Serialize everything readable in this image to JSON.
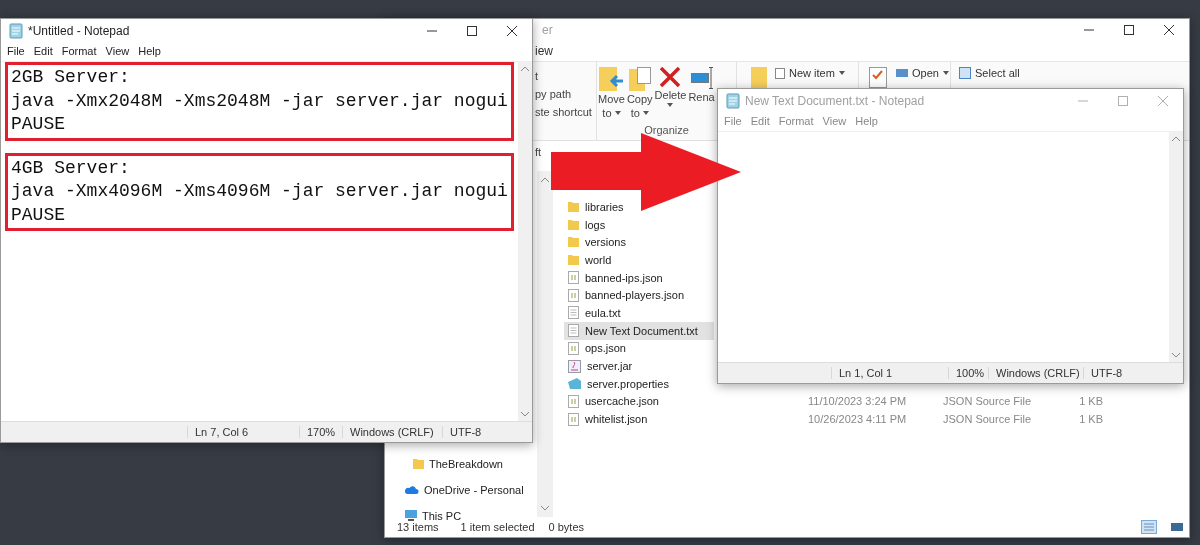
{
  "explorer": {
    "title": "er",
    "tabs": [
      "iew"
    ],
    "clipboard": [
      "t",
      "py path",
      "ste shortcut"
    ],
    "organize": {
      "label": "Organize",
      "buttons": [
        {
          "kind": "move",
          "label": "Move",
          "sub": "to"
        },
        {
          "kind": "copy",
          "label": "Copy",
          "sub": "to"
        },
        {
          "kind": "delete",
          "label": "Delete"
        },
        {
          "kind": "rename",
          "label": "Rena"
        }
      ]
    },
    "new_item": "New item",
    "open": "Open",
    "select_all": "Select all",
    "nav_heading": "ft",
    "nav_items": [
      {
        "kind": "folder",
        "label": "TheBreakdown"
      },
      {
        "kind": "cloud",
        "label": "OneDrive - Personal"
      },
      {
        "kind": "pc",
        "label": "This PC"
      }
    ],
    "files": [
      {
        "kind": "folder",
        "name": "libraries",
        "selected": false
      },
      {
        "kind": "folder",
        "name": "logs",
        "selected": false
      },
      {
        "kind": "folder",
        "name": "versions",
        "selected": false
      },
      {
        "kind": "folder",
        "name": "world",
        "selected": false
      },
      {
        "kind": "json",
        "name": "banned-ips.json",
        "selected": false
      },
      {
        "kind": "json",
        "name": "banned-players.json",
        "selected": false
      },
      {
        "kind": "text",
        "name": "eula.txt",
        "selected": false
      },
      {
        "kind": "text",
        "name": "New Text Document.txt",
        "selected": true
      },
      {
        "kind": "json",
        "name": "ops.json",
        "selected": false
      },
      {
        "kind": "jar",
        "name": "server.jar",
        "selected": false
      },
      {
        "kind": "properties",
        "name": "server.properties",
        "selected": false
      },
      {
        "kind": "json",
        "name": "usercache.json",
        "selected": false,
        "date": "11/10/2023 3:24 PM",
        "type": "JSON Source File",
        "size": "1 KB"
      },
      {
        "kind": "json",
        "name": "whitelist.json",
        "selected": false,
        "date": "10/26/2023 4:11 PM",
        "type": "JSON Source File",
        "size": "1 KB"
      }
    ],
    "status": [
      "13 items",
      "1 item selected",
      "0 bytes"
    ]
  },
  "notepad_new": {
    "title": "New Text Document.txt - Notepad",
    "active": false,
    "menu": [
      "File",
      "Edit",
      "Format",
      "View",
      "Help"
    ],
    "status": [
      "Ln 1, Col 1",
      "100%",
      "Windows (CRLF)",
      "UTF-8"
    ]
  },
  "notepad_main": {
    "title": "*Untitled - Notepad",
    "active": true,
    "menu": [
      "File",
      "Edit",
      "Format",
      "View",
      "Help"
    ],
    "blocks": [
      {
        "outlined": true,
        "lines": [
          "2GB Server:",
          "java -Xmx2048M -Xms2048M -jar server.jar nogui",
          "PAUSE"
        ]
      },
      {
        "outlined": true,
        "lines": [
          "4GB Server:",
          "java -Xmx4096M -Xms4096M -jar server.jar nogui",
          "PAUSE"
        ]
      }
    ],
    "status": [
      "Ln 7, Col 6",
      "170%",
      "Windows (CRLF)",
      "UTF-8"
    ]
  }
}
